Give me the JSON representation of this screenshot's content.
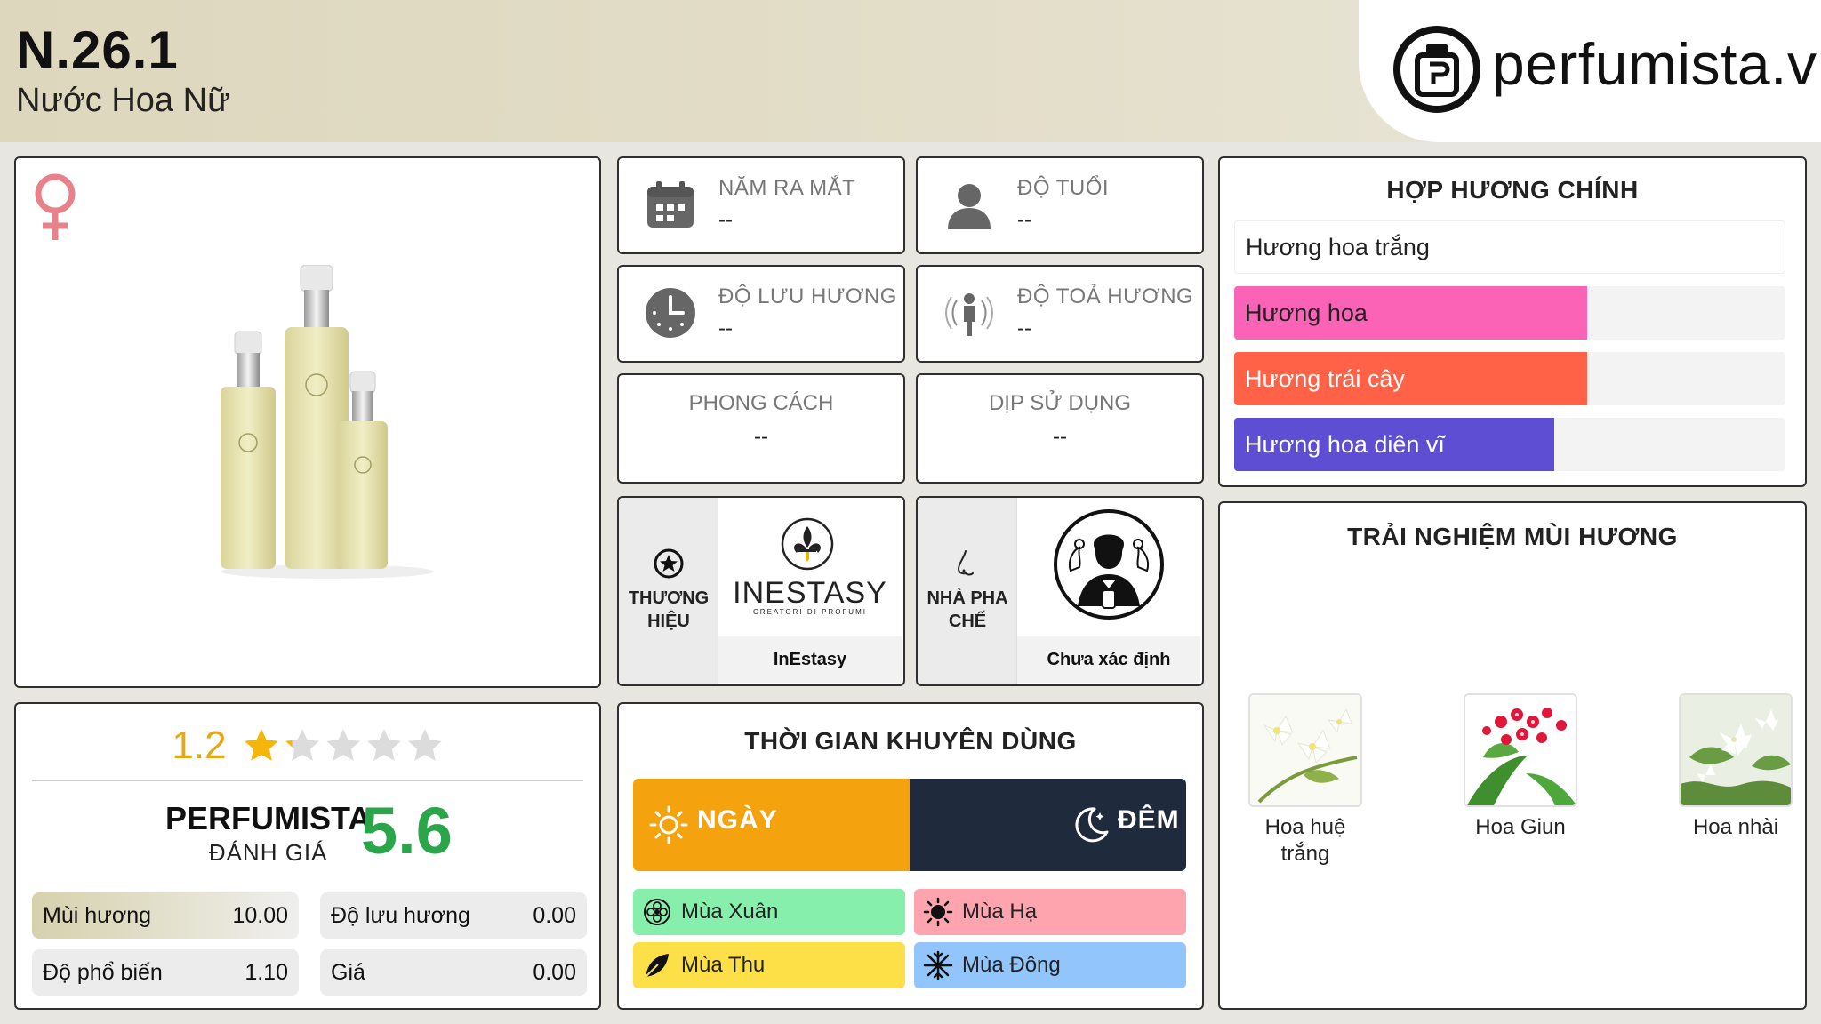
{
  "header": {
    "title": "N.26.1",
    "subtitle": "Nước Hoa Nữ",
    "logo_text": "perfumista.vn"
  },
  "product": {
    "gender_icon": "female-symbol-icon"
  },
  "rating": {
    "value": "1.2",
    "stars_filled": 1.2,
    "stars_total": 5,
    "brand_label": "PERFUMISTA",
    "brand_sub": "ĐÁNH GIÁ",
    "score": "5.6",
    "metrics": [
      {
        "label": "Mùi hương",
        "value": "10.00"
      },
      {
        "label": "Độ lưu hương",
        "value": "0.00"
      },
      {
        "label": "Độ phổ biến",
        "value": "1.10"
      },
      {
        "label": "Giá",
        "value": "0.00"
      }
    ]
  },
  "info": {
    "release_year": {
      "label": "NĂM RA MẮT",
      "value": "--",
      "icon": "calendar-icon"
    },
    "age": {
      "label": "ĐỘ TUỔI",
      "value": "--",
      "icon": "user-icon"
    },
    "longevity": {
      "label": "ĐỘ LƯU HƯƠNG",
      "value": "--",
      "icon": "clock-icon"
    },
    "sillage": {
      "label": "ĐỘ TOẢ HƯƠNG",
      "value": "--",
      "icon": "sillage-icon"
    },
    "style": {
      "label": "PHONG CÁCH",
      "value": "--"
    },
    "occasion": {
      "label": "DỊP SỬ DỤNG",
      "value": "--"
    }
  },
  "brand": {
    "label_line1": "THƯƠNG",
    "label_line2": "HIỆU",
    "logo_main": "INESTASY",
    "logo_sub": "CREATORI DI PROFUMI",
    "name": "InEstasy"
  },
  "perfumer": {
    "label_line1": "NHÀ PHA",
    "label_line2": "CHẾ",
    "name": "Chưa xác định"
  },
  "accords": {
    "title": "HỢP HƯƠNG CHÍNH",
    "items": [
      {
        "label": "Hương hoa trắng",
        "level": 100,
        "color": "#ffffff",
        "text_color": "#222222"
      },
      {
        "label": "Hương hoa",
        "level": 64,
        "color": "#fb64b6",
        "text_color": "#222222"
      },
      {
        "label": "Hương trái cây",
        "level": 64,
        "color": "#ff6246",
        "text_color": "#ffffff"
      },
      {
        "label": "Hương hoa diên vĩ",
        "level": 58,
        "color": "#5d4ed4",
        "text_color": "#ffffff"
      }
    ]
  },
  "time": {
    "title": "THỜI GIAN KHUYÊN DÙNG",
    "day": "NGÀY",
    "night": "ĐÊM",
    "seasons": [
      {
        "label": "Mùa Xuân",
        "color": "#86efac",
        "icon": "flower-icon"
      },
      {
        "label": "Mùa Hạ",
        "color": "#fda4af",
        "icon": "sun-icon"
      },
      {
        "label": "Mùa Thu",
        "color": "#fde047",
        "icon": "leaf-icon"
      },
      {
        "label": "Mùa Đông",
        "color": "#93c5fd",
        "icon": "snowflake-icon"
      }
    ]
  },
  "notes": {
    "title": "TRẢI NGHIỆM MÙI HƯƠNG",
    "items": [
      {
        "name_line1": "Hoa huệ",
        "name_line2": "trắng"
      },
      {
        "name_line1": "Hoa Giun",
        "name_line2": ""
      },
      {
        "name_line1": "Hoa nhài",
        "name_line2": ""
      }
    ]
  }
}
